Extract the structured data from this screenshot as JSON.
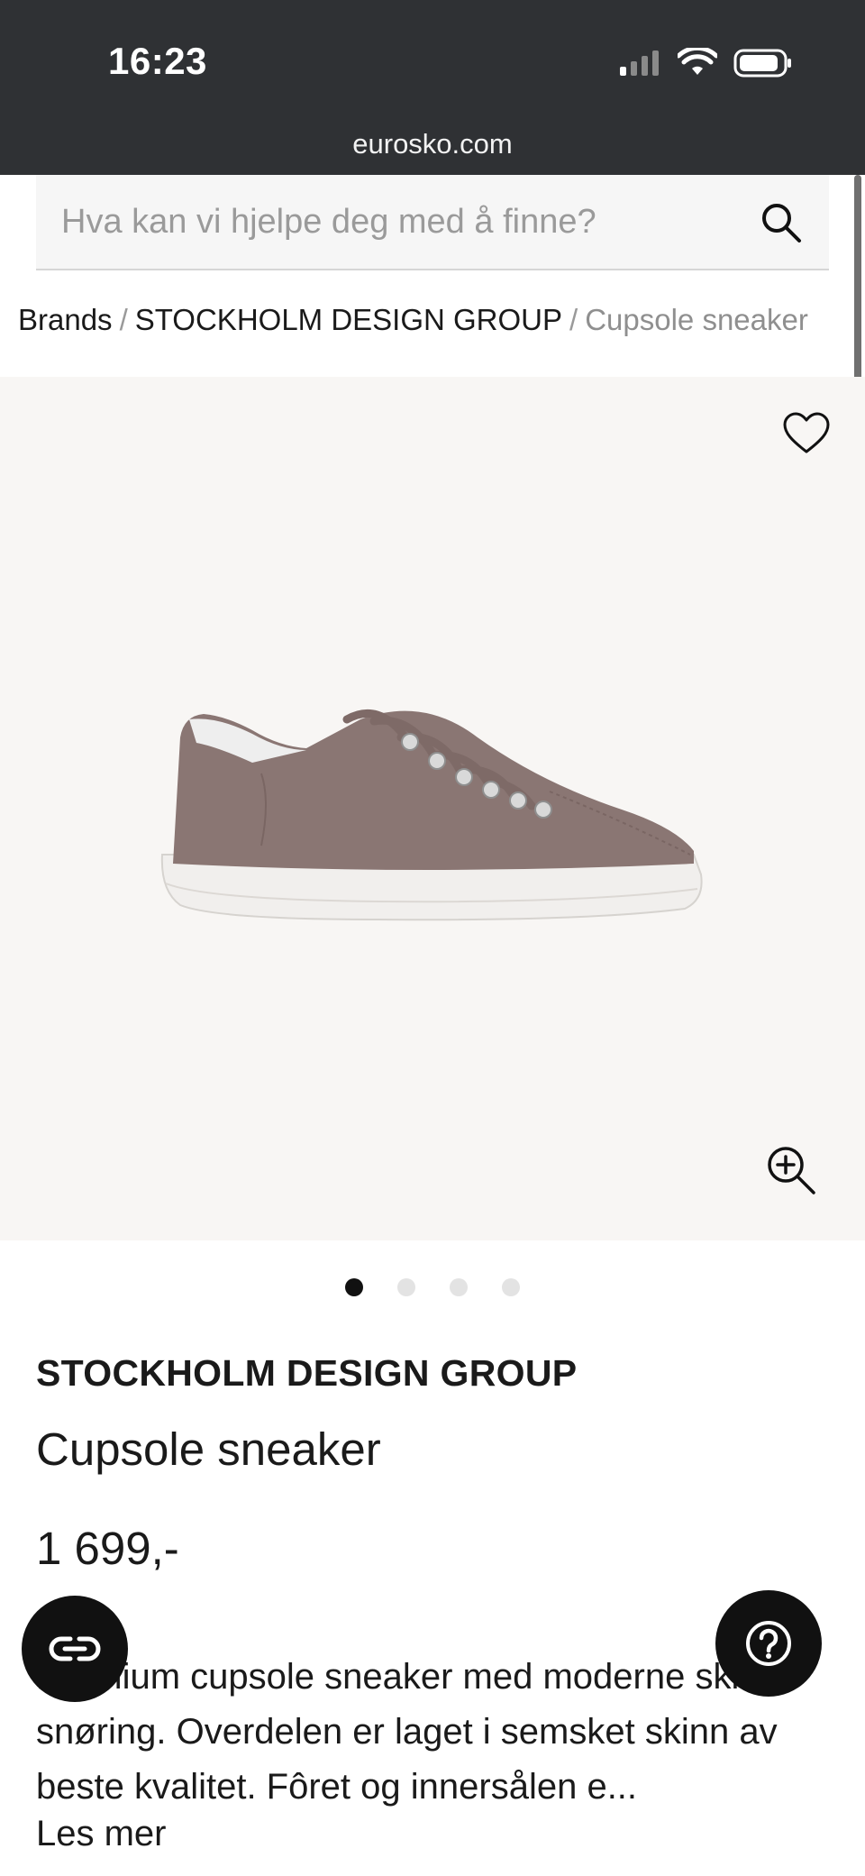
{
  "status_bar": {
    "time": "16:23",
    "url": "eurosko.com"
  },
  "search": {
    "placeholder": "Hva kan vi hjelpe deg med å finne?"
  },
  "breadcrumb": {
    "items": [
      "Brands",
      "STOCKHOLM DESIGN GROUP",
      "Cupsole sneaker"
    ],
    "separator": "/"
  },
  "gallery": {
    "image_count": 4,
    "active_index": 0
  },
  "product": {
    "brand": "STOCKHOLM DESIGN GROUP",
    "name": "Cupsole sneaker",
    "price": "1 699,-",
    "description": "Premium cupsole sneaker med moderne skisko-snøring. Overdelen er laget i semsket skinn av beste kvalitet. Fôret og innersålen e...",
    "read_more": "Les mer"
  },
  "colors": {
    "status_bar_bg": "#2f3134",
    "gallery_bg": "#f8f6f4",
    "shoe_suede": "#8a7673",
    "fab_bg": "#111111"
  },
  "icons": {
    "search": "search-icon",
    "favorite": "heart-icon",
    "zoom": "zoom-in-icon",
    "chat": "chat-link-icon",
    "help": "help-question-icon"
  }
}
